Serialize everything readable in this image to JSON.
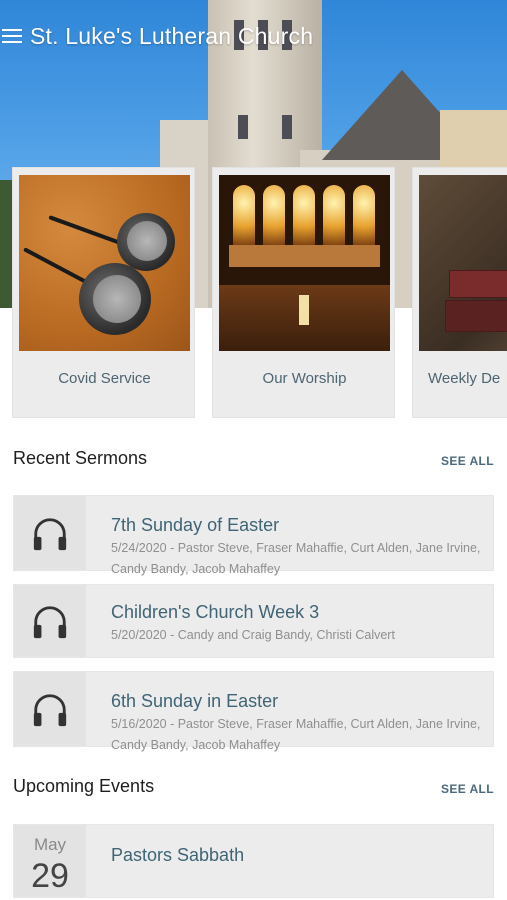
{
  "app": {
    "title": "St. Luke's Lutheran Church",
    "menu_icon": "hamburger-menu-icon"
  },
  "featured_cards": [
    {
      "label": "Covid Service",
      "image": "earbuds"
    },
    {
      "label": "Our Worship",
      "image": "last-supper-altar"
    },
    {
      "label": "Weekly De",
      "image": "books"
    }
  ],
  "recent_sermons": {
    "title": "Recent Sermons",
    "see_all": "SEE ALL",
    "items": [
      {
        "title": "7th Sunday of Easter",
        "meta": "5/24/2020 - Pastor Steve, Fraser Mahaffie, Curt Alden, Jane Irvine, Candy Bandy, Jacob Mahaffey",
        "icon": "headphones-icon"
      },
      {
        "title": "Children's Church Week 3",
        "meta": "5/20/2020 - Candy and Craig Bandy, Christi Calvert",
        "icon": "headphones-icon"
      },
      {
        "title": "6th Sunday in Easter",
        "meta": "5/16/2020 - Pastor Steve, Fraser Mahaffie, Curt Alden, Jane Irvine, Candy Bandy, Jacob Mahaffey",
        "icon": "headphones-icon"
      }
    ]
  },
  "upcoming_events": {
    "title": "Upcoming Events",
    "see_all": "SEE ALL",
    "items": [
      {
        "month": "May",
        "day": "29",
        "title": "Pastors Sabbath"
      }
    ]
  },
  "colors": {
    "accent_text": "#3f6475",
    "card_bg": "#ececec",
    "sky": "#2f86d8"
  }
}
